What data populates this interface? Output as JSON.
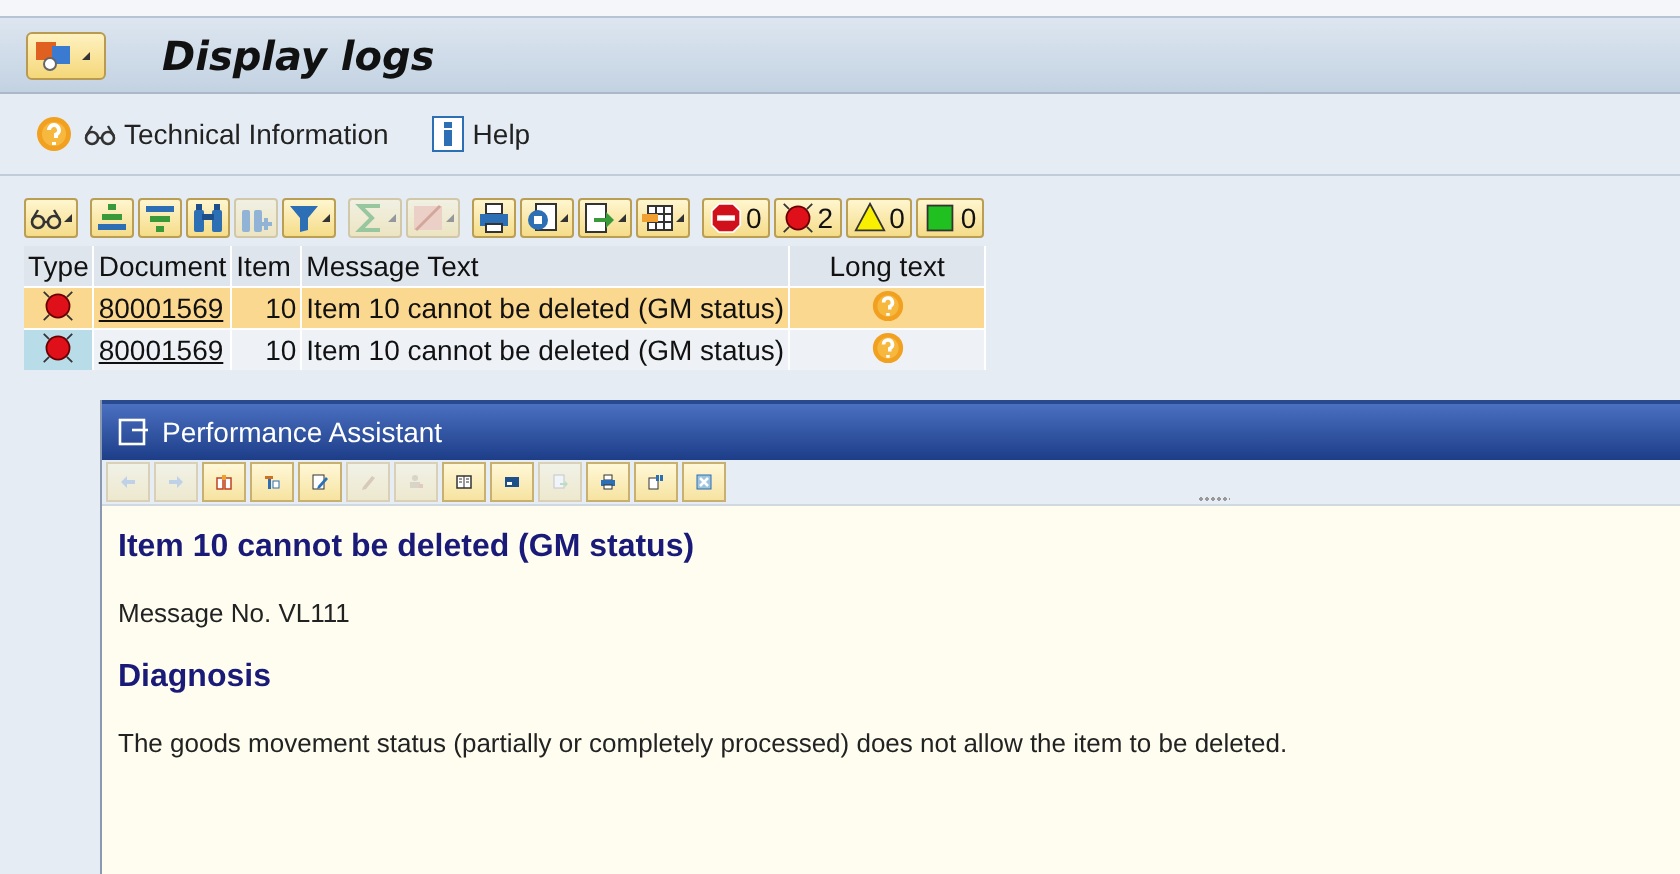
{
  "window": {
    "title": "Display logs"
  },
  "menu_toolbar": {
    "items": [
      {
        "kind": "tech",
        "label": "Technical Information"
      },
      {
        "kind": "help",
        "label": "Help"
      }
    ]
  },
  "alv_toolbar": {
    "button_groups": [
      [
        {
          "disabled": false,
          "menu": true
        }
      ],
      [
        {
          "disabled": false,
          "menu": false
        },
        {
          "disabled": false,
          "menu": false
        },
        {
          "disabled": false,
          "menu": false
        },
        {
          "disabled": true,
          "menu": false
        },
        {
          "disabled": false,
          "menu": true
        }
      ],
      [
        {
          "disabled": true,
          "menu": true
        },
        {
          "disabled": true,
          "menu": true
        }
      ],
      [
        {
          "disabled": false,
          "menu": false
        },
        {
          "disabled": false,
          "menu": true
        },
        {
          "disabled": false,
          "menu": true
        },
        {
          "disabled": false,
          "menu": true
        }
      ]
    ],
    "counters": [
      {
        "kind": "stop",
        "count": "0"
      },
      {
        "kind": "error",
        "count": "2"
      },
      {
        "kind": "warning",
        "count": "0"
      },
      {
        "kind": "success",
        "count": "0"
      }
    ]
  },
  "table": {
    "columns": [
      "Type",
      "Document",
      "Item",
      "Message Text",
      "Long text"
    ],
    "rows": [
      {
        "selected": true,
        "kind": "error",
        "document": "80001569",
        "item": "10",
        "message": "Item 10 cannot be deleted (GM status)"
      },
      {
        "selected": false,
        "kind": "error",
        "document": "80001569",
        "item": "10",
        "message": "Item 10 cannot be deleted (GM status)"
      }
    ]
  },
  "performance_assistant": {
    "title": "Performance Assistant",
    "toolbar": [
      {
        "disabled": true
      },
      {
        "disabled": true
      },
      {
        "disabled": false
      },
      {
        "disabled": false
      },
      {
        "disabled": false
      },
      {
        "disabled": true
      },
      {
        "disabled": true
      },
      {
        "disabled": false
      },
      {
        "disabled": false
      },
      {
        "disabled": true
      },
      {
        "disabled": false
      },
      {
        "disabled": false
      },
      {
        "disabled": false
      }
    ],
    "heading": "Item 10 cannot be deleted (GM status)",
    "message_no": "Message No. VL111",
    "section_title": "Diagnosis",
    "body": "The goods movement status (partially or completely processed) does not allow the item to be deleted."
  }
}
